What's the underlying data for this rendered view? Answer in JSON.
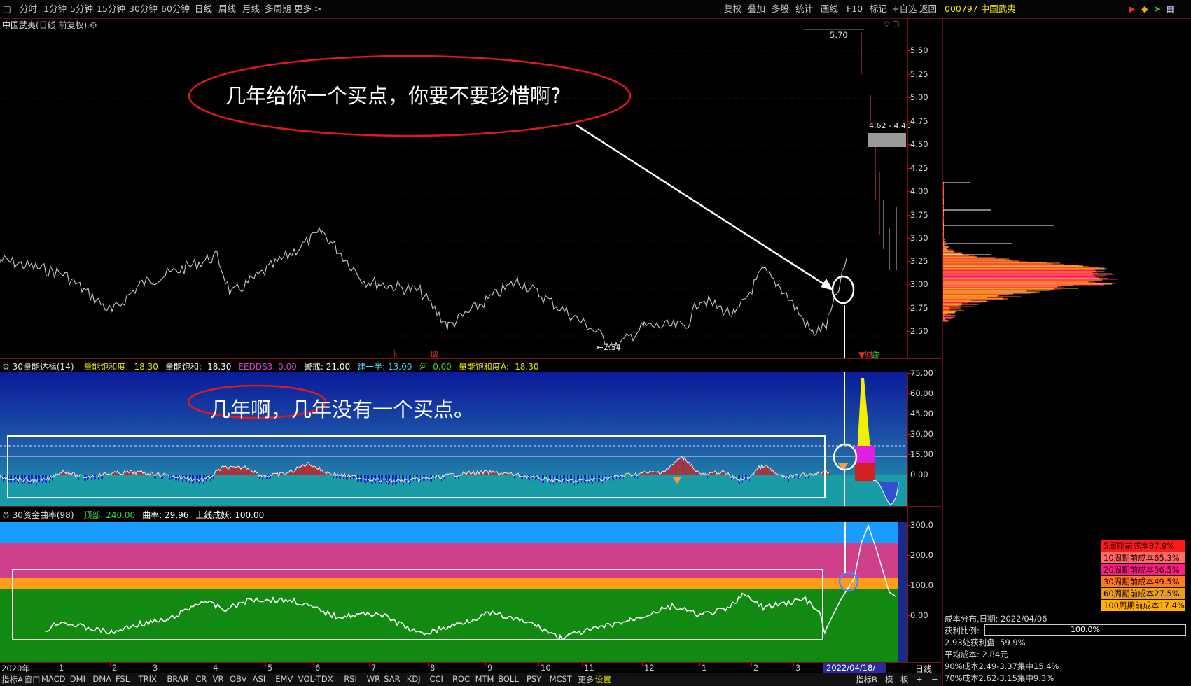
{
  "toolbar": {
    "period_tabs": [
      "分时",
      "1分钟",
      "5分钟",
      "15分钟",
      "30分钟",
      "60分钟",
      "日线",
      "周线",
      "月线",
      "多周期",
      "更多 >"
    ],
    "right_tabs": [
      "复权",
      "叠加",
      "多股",
      "统计",
      "画线",
      "F10",
      "标记",
      "+自选",
      "返回"
    ],
    "stock_code_name": "000797 中国武夷"
  },
  "main_chart": {
    "title": "中国武夷",
    "subtitle": "(日线 前复权)",
    "high_label": "5.70",
    "low_label": "2.34",
    "range_label": "4.62 - 4.40",
    "annotation_1": "几年给你一个买点，你要不要珍惜啊?",
    "markers": [
      "$",
      "增",
      "财",
      "跌"
    ],
    "y_ticks": [
      "5.50",
      "5.25",
      "5.00",
      "4.75",
      "4.50",
      "4.25",
      "4.00",
      "3.75",
      "3.50",
      "3.25",
      "3.00",
      "2.75",
      "2.50"
    ]
  },
  "indicator_1": {
    "name": "30量能达标(14)",
    "legend": [
      {
        "label": "量能饱和度: -18.30",
        "color": "#e8e800"
      },
      {
        "label": "量能饱和: -18.30",
        "color": "#ffffff"
      },
      {
        "label": "EEDDS3: 0.00",
        "color": "#d040d0"
      },
      {
        "label": "警戒: 21.00",
        "color": "#ffffff"
      },
      {
        "label": "建一半: 13.00",
        "color": "#40d0ff"
      },
      {
        "label": "河: 0.00",
        "color": "#40d040"
      },
      {
        "label": "量能饱和度A: -18.30",
        "color": "#e8e800"
      }
    ],
    "annotation_2": "几年啊，几年没有一个买点。",
    "y_ticks": [
      "75.00",
      "60.00",
      "45.00",
      "30.00",
      "15.00",
      "0.00"
    ]
  },
  "indicator_2": {
    "name": "30资金曲率(98)",
    "legend": [
      {
        "label": "顶部: 240.00",
        "color": "#40d040"
      },
      {
        "label": "曲率: 29.96",
        "color": "#ffffff"
      },
      {
        "label": "上线成妖: 100.00",
        "color": "#ffffff"
      }
    ],
    "y_ticks": [
      "300.0",
      "200.0",
      "100.0",
      "0.00"
    ]
  },
  "time_axis": {
    "labels": [
      "2020年",
      "1",
      "2",
      "3",
      "4",
      "5",
      "6",
      "7",
      "8",
      "9",
      "10",
      "11",
      "12",
      "1",
      "2",
      "3"
    ],
    "current_date": "2022/04/18/—",
    "period_label": "日线"
  },
  "bottom_tabs": [
    "指标A",
    "窗口",
    "MACD",
    "DMI",
    "DMA",
    "FSL",
    "TRIX",
    "BRAR",
    "CR",
    "VR",
    "OBV",
    "ASI",
    "EMV",
    "VOL-TDX",
    "RSI",
    "WR",
    "SAR",
    "KDJ",
    "CCI",
    "ROC",
    "MTM",
    "BOLL",
    "PSY",
    "MCST",
    "更多",
    "设置"
  ],
  "bottom_right_tabs": [
    "指标B",
    "模",
    "板",
    "+",
    "−"
  ],
  "cost_distribution": {
    "legend": [
      {
        "label": "5周期前成本87.9%",
        "color": "#ff1a1a"
      },
      {
        "label": "10周期前成本65.3%",
        "color": "#ff6a6a"
      },
      {
        "label": "20周期前成本56.5%",
        "color": "#ff1a8a"
      },
      {
        "label": "30周期前成本49.5%",
        "color": "#ff7a1a"
      },
      {
        "label": "60周期前成本27.5%",
        "color": "#e8a020"
      },
      {
        "label": "100周期前成本17.4%",
        "color": "#ffb000"
      }
    ],
    "date_line": "成本分布,日期: 2022/04/06",
    "profit_label": "获利比例:",
    "profit_value": "100.0%",
    "profit_fraction": 1.0,
    "lines": [
      "2.93处获利盘: 59.9%",
      "平均成本: 2.84元",
      "90%成本2.49-3.37集中15.4%",
      "70%成本2.62-3.15集中9.3%"
    ]
  }
}
